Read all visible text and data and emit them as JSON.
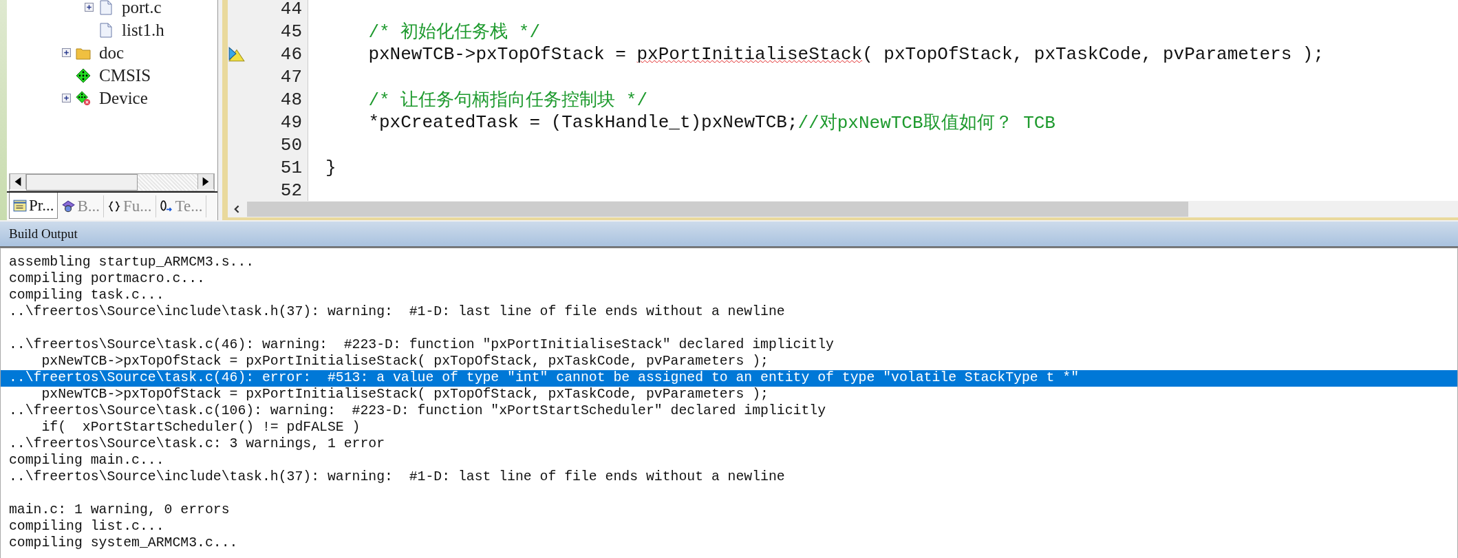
{
  "tree": {
    "items": [
      {
        "kind": "group",
        "children": [
          {
            "label": "port.c",
            "kind": "file",
            "expanded": false
          },
          {
            "label": "list1.h",
            "kind": "file"
          }
        ]
      },
      {
        "label": "doc",
        "kind": "folder",
        "expanded": false
      },
      {
        "label": "CMSIS",
        "kind": "component"
      },
      {
        "label": "Device",
        "kind": "component-error",
        "expanded": false
      }
    ]
  },
  "panel_tabs": [
    {
      "label": "Pr...",
      "kind": "project",
      "selected": true
    },
    {
      "label": "B...",
      "kind": "books",
      "selected": false
    },
    {
      "label": "Fu...",
      "kind": "functions",
      "selected": false
    },
    {
      "label": "Te...",
      "kind": "templates",
      "selected": false
    }
  ],
  "editor": {
    "lines": [
      {
        "number": "44",
        "marker": false
      },
      {
        "number": "45",
        "marker": false,
        "segments": [
          {
            "kind": "comment",
            "text": "    /* 初始化任务栈 */"
          }
        ]
      },
      {
        "number": "46",
        "marker": true,
        "segments": [
          {
            "kind": "code",
            "text": "    pxNewTCB->pxTopOfStack = "
          },
          {
            "kind": "code",
            "text": "pxPortInitialiseStack",
            "misspelled": true
          },
          {
            "kind": "code",
            "text": "( pxTopOfStack, pxTaskCode, pvParameters );"
          }
        ]
      },
      {
        "number": "47",
        "marker": false
      },
      {
        "number": "48",
        "marker": false,
        "segments": [
          {
            "kind": "comment",
            "text": "    /* 让任务句柄指向任务控制块 */"
          }
        ]
      },
      {
        "number": "49",
        "marker": false,
        "segments": [
          {
            "kind": "code",
            "text": "    *pxCreatedTask = (TaskHandle_t)pxNewTCB;"
          },
          {
            "kind": "comment",
            "text": "//对pxNewTCB取值如何？ TCB"
          }
        ]
      },
      {
        "number": "50",
        "marker": false
      },
      {
        "number": "51",
        "marker": false,
        "segments": [
          {
            "kind": "code",
            "text": "}"
          }
        ]
      },
      {
        "number": "52",
        "marker": false
      }
    ]
  },
  "build_output": {
    "title": "Build Output",
    "lines": [
      {
        "kind": "text",
        "text": "assembling startup_ARMCM3.s...",
        "selected": false
      },
      {
        "kind": "text",
        "text": "compiling portmacro.c...",
        "selected": false
      },
      {
        "kind": "text",
        "text": "compiling task.c...",
        "selected": false
      },
      {
        "kind": "text",
        "text": "..\\freertos\\Source\\include\\task.h(37): warning:  #1-D: last line of file ends without a newline",
        "selected": false
      },
      {
        "kind": "blank"
      },
      {
        "kind": "text",
        "text": "..\\freertos\\Source\\task.c(46): warning:  #223-D: function \"pxPortInitialiseStack\" declared implicitly",
        "selected": false
      },
      {
        "kind": "text",
        "text": "    pxNewTCB->pxTopOfStack = pxPortInitialiseStack( pxTopOfStack, pxTaskCode, pvParameters );",
        "selected": false
      },
      {
        "kind": "text",
        "text": "..\\freertos\\Source\\task.c(46): error:  #513: a value of type \"int\" cannot be assigned to an entity of type \"volatile StackType t *\"",
        "selected": true
      },
      {
        "kind": "text",
        "text": "    pxNewTCB->pxTopOfStack = pxPortInitialiseStack( pxTopOfStack, pxTaskCode, pvParameters );",
        "selected": false
      },
      {
        "kind": "text",
        "text": "..\\freertos\\Source\\task.c(106): warning:  #223-D: function \"xPortStartScheduler\" declared implicitly",
        "selected": false
      },
      {
        "kind": "text",
        "text": "    if(  xPortStartScheduler() != pdFALSE )",
        "selected": false
      },
      {
        "kind": "text",
        "text": "..\\freertos\\Source\\task.c: 3 warnings, 1 error",
        "selected": false
      },
      {
        "kind": "text",
        "text": "compiling main.c...",
        "selected": false
      },
      {
        "kind": "text",
        "text": "..\\freertos\\Source\\include\\task.h(37): warning:  #1-D: last line of file ends without a newline",
        "selected": false
      },
      {
        "kind": "blank"
      },
      {
        "kind": "text",
        "text": "main.c: 1 warning, 0 errors",
        "selected": false
      },
      {
        "kind": "text",
        "text": "compiling list.c...",
        "selected": false
      },
      {
        "kind": "text",
        "text": "compiling system_ARMCM3.c...",
        "selected": false
      }
    ]
  }
}
